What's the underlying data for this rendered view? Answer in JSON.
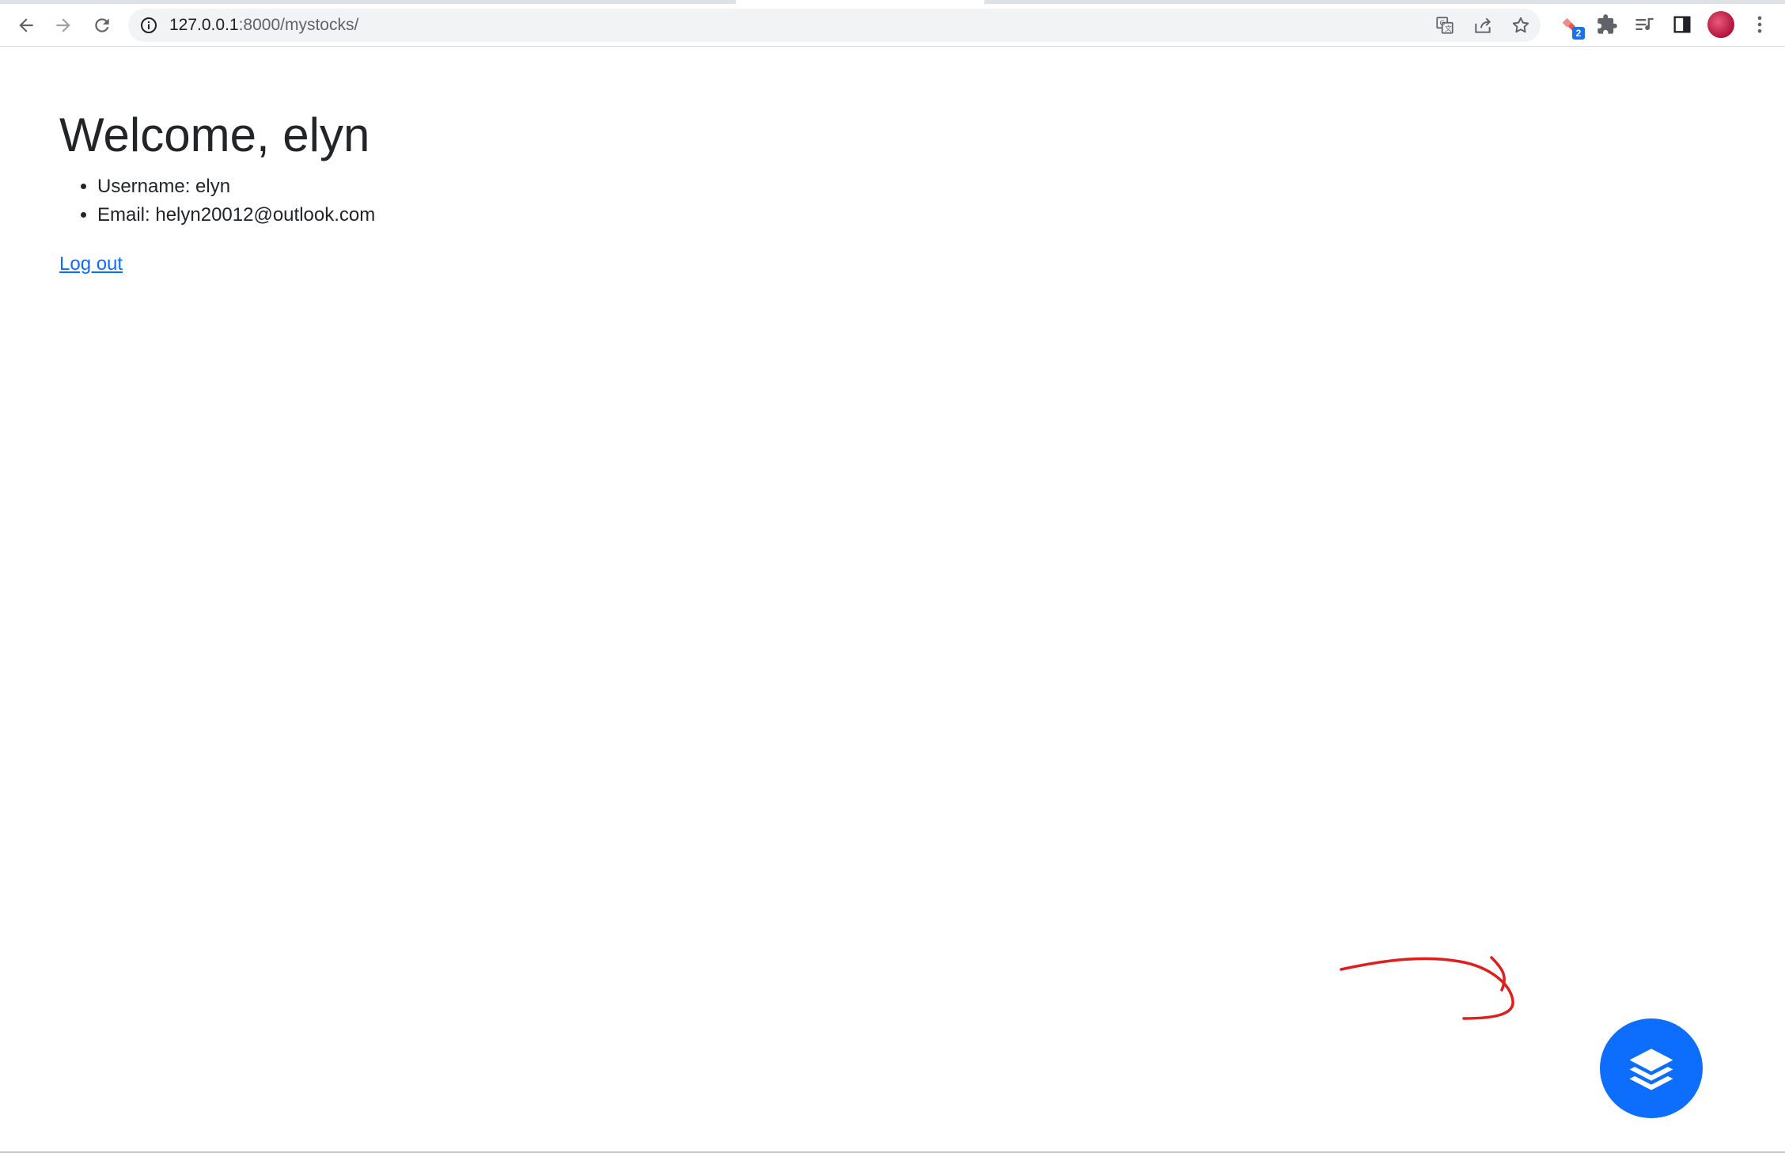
{
  "browser": {
    "url_host": "127.0.0.1",
    "url_path": ":8000/mystocks/",
    "extension_badge": "2",
    "icons": {
      "back": "arrow-left-icon",
      "forward": "arrow-right-icon",
      "reload": "reload-icon",
      "site_info": "info-icon",
      "translate": "translate-icon",
      "share": "share-icon",
      "bookmark": "star-icon",
      "extension": "extension-logo-icon",
      "extensions_menu": "puzzle-icon",
      "reading_list": "reading-list-icon",
      "side_panel": "side-panel-icon",
      "menu": "kebab-menu-icon"
    }
  },
  "page": {
    "heading": "Welcome, elyn",
    "details": [
      "Username: elyn",
      "Email: helyn20012@outlook.com"
    ],
    "logout_link": "Log out"
  },
  "fab": {
    "icon": "layers-icon",
    "color": "#0d6efd"
  },
  "annotation": {
    "type": "hand-drawn-arrow",
    "color": "#e01e1e"
  }
}
